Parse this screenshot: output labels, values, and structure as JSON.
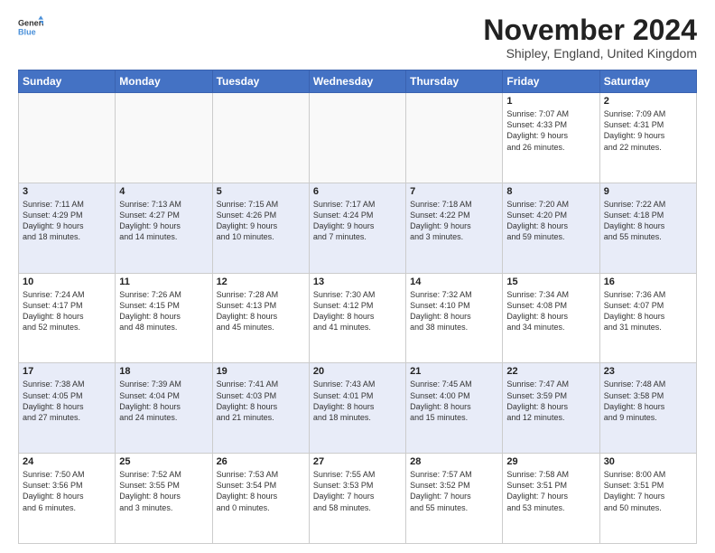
{
  "header": {
    "logo_general": "General",
    "logo_blue": "Blue",
    "month_title": "November 2024",
    "subtitle": "Shipley, England, United Kingdom"
  },
  "weekdays": [
    "Sunday",
    "Monday",
    "Tuesday",
    "Wednesday",
    "Thursday",
    "Friday",
    "Saturday"
  ],
  "rows": [
    [
      {
        "day": "",
        "info": ""
      },
      {
        "day": "",
        "info": ""
      },
      {
        "day": "",
        "info": ""
      },
      {
        "day": "",
        "info": ""
      },
      {
        "day": "",
        "info": ""
      },
      {
        "day": "1",
        "info": "Sunrise: 7:07 AM\nSunset: 4:33 PM\nDaylight: 9 hours\nand 26 minutes."
      },
      {
        "day": "2",
        "info": "Sunrise: 7:09 AM\nSunset: 4:31 PM\nDaylight: 9 hours\nand 22 minutes."
      }
    ],
    [
      {
        "day": "3",
        "info": "Sunrise: 7:11 AM\nSunset: 4:29 PM\nDaylight: 9 hours\nand 18 minutes."
      },
      {
        "day": "4",
        "info": "Sunrise: 7:13 AM\nSunset: 4:27 PM\nDaylight: 9 hours\nand 14 minutes."
      },
      {
        "day": "5",
        "info": "Sunrise: 7:15 AM\nSunset: 4:26 PM\nDaylight: 9 hours\nand 10 minutes."
      },
      {
        "day": "6",
        "info": "Sunrise: 7:17 AM\nSunset: 4:24 PM\nDaylight: 9 hours\nand 7 minutes."
      },
      {
        "day": "7",
        "info": "Sunrise: 7:18 AM\nSunset: 4:22 PM\nDaylight: 9 hours\nand 3 minutes."
      },
      {
        "day": "8",
        "info": "Sunrise: 7:20 AM\nSunset: 4:20 PM\nDaylight: 8 hours\nand 59 minutes."
      },
      {
        "day": "9",
        "info": "Sunrise: 7:22 AM\nSunset: 4:18 PM\nDaylight: 8 hours\nand 55 minutes."
      }
    ],
    [
      {
        "day": "10",
        "info": "Sunrise: 7:24 AM\nSunset: 4:17 PM\nDaylight: 8 hours\nand 52 minutes."
      },
      {
        "day": "11",
        "info": "Sunrise: 7:26 AM\nSunset: 4:15 PM\nDaylight: 8 hours\nand 48 minutes."
      },
      {
        "day": "12",
        "info": "Sunrise: 7:28 AM\nSunset: 4:13 PM\nDaylight: 8 hours\nand 45 minutes."
      },
      {
        "day": "13",
        "info": "Sunrise: 7:30 AM\nSunset: 4:12 PM\nDaylight: 8 hours\nand 41 minutes."
      },
      {
        "day": "14",
        "info": "Sunrise: 7:32 AM\nSunset: 4:10 PM\nDaylight: 8 hours\nand 38 minutes."
      },
      {
        "day": "15",
        "info": "Sunrise: 7:34 AM\nSunset: 4:08 PM\nDaylight: 8 hours\nand 34 minutes."
      },
      {
        "day": "16",
        "info": "Sunrise: 7:36 AM\nSunset: 4:07 PM\nDaylight: 8 hours\nand 31 minutes."
      }
    ],
    [
      {
        "day": "17",
        "info": "Sunrise: 7:38 AM\nSunset: 4:05 PM\nDaylight: 8 hours\nand 27 minutes."
      },
      {
        "day": "18",
        "info": "Sunrise: 7:39 AM\nSunset: 4:04 PM\nDaylight: 8 hours\nand 24 minutes."
      },
      {
        "day": "19",
        "info": "Sunrise: 7:41 AM\nSunset: 4:03 PM\nDaylight: 8 hours\nand 21 minutes."
      },
      {
        "day": "20",
        "info": "Sunrise: 7:43 AM\nSunset: 4:01 PM\nDaylight: 8 hours\nand 18 minutes."
      },
      {
        "day": "21",
        "info": "Sunrise: 7:45 AM\nSunset: 4:00 PM\nDaylight: 8 hours\nand 15 minutes."
      },
      {
        "day": "22",
        "info": "Sunrise: 7:47 AM\nSunset: 3:59 PM\nDaylight: 8 hours\nand 12 minutes."
      },
      {
        "day": "23",
        "info": "Sunrise: 7:48 AM\nSunset: 3:58 PM\nDaylight: 8 hours\nand 9 minutes."
      }
    ],
    [
      {
        "day": "24",
        "info": "Sunrise: 7:50 AM\nSunset: 3:56 PM\nDaylight: 8 hours\nand 6 minutes."
      },
      {
        "day": "25",
        "info": "Sunrise: 7:52 AM\nSunset: 3:55 PM\nDaylight: 8 hours\nand 3 minutes."
      },
      {
        "day": "26",
        "info": "Sunrise: 7:53 AM\nSunset: 3:54 PM\nDaylight: 8 hours\nand 0 minutes."
      },
      {
        "day": "27",
        "info": "Sunrise: 7:55 AM\nSunset: 3:53 PM\nDaylight: 7 hours\nand 58 minutes."
      },
      {
        "day": "28",
        "info": "Sunrise: 7:57 AM\nSunset: 3:52 PM\nDaylight: 7 hours\nand 55 minutes."
      },
      {
        "day": "29",
        "info": "Sunrise: 7:58 AM\nSunset: 3:51 PM\nDaylight: 7 hours\nand 53 minutes."
      },
      {
        "day": "30",
        "info": "Sunrise: 8:00 AM\nSunset: 3:51 PM\nDaylight: 7 hours\nand 50 minutes."
      }
    ]
  ]
}
